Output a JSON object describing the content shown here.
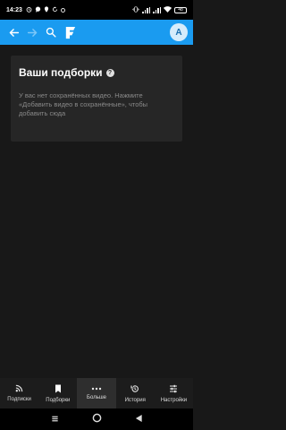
{
  "status_bar": {
    "time": "14:23",
    "battery": "48"
  },
  "app_bar": {
    "avatar_letter": "A"
  },
  "card": {
    "title": "Ваши подборки",
    "help_symbol": "?",
    "text": "У вас нет сохранённых видео. Нажмите «Добавить видео в сохранённые», чтобы добавить сюда"
  },
  "bottom_nav": {
    "items": [
      {
        "label": "Подписки",
        "icon": "rss-icon"
      },
      {
        "label": "Подборки",
        "icon": "bookmark-icon",
        "active": true
      },
      {
        "label": "Больше",
        "icon": "more-dots-icon"
      },
      {
        "label": "История",
        "icon": "history-icon"
      },
      {
        "label": "Настройки",
        "icon": "sliders-icon"
      }
    ]
  },
  "colors": {
    "accent": "#1a9bf0",
    "background": "#181818",
    "card": "#262626",
    "muted_text": "#8a8a8a"
  }
}
